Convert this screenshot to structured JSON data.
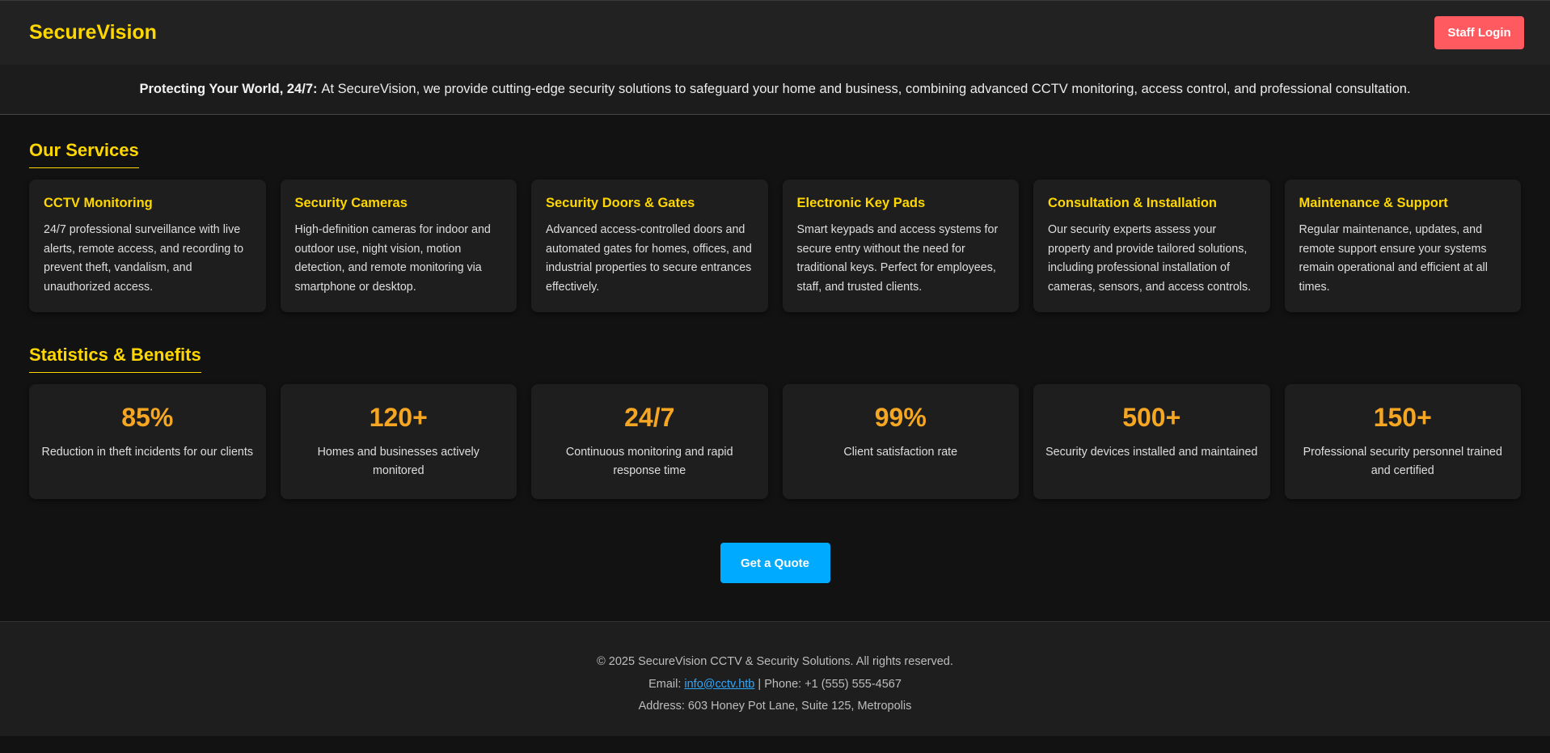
{
  "header": {
    "brand": "SecureVision",
    "login_label": "Staff Login"
  },
  "intro": {
    "lead": "Protecting Your World, 24/7:",
    "text": "At SecureVision, we provide cutting-edge security solutions to safeguard your home and business, combining advanced CCTV monitoring, access control, and professional consultation."
  },
  "services": {
    "title": "Our Services",
    "items": [
      {
        "title": "CCTV Monitoring",
        "desc": "24/7 professional surveillance with live alerts, remote access, and recording to prevent theft, vandalism, and unauthorized access."
      },
      {
        "title": "Security Cameras",
        "desc": "High-definition cameras for indoor and outdoor use, night vision, motion detection, and remote monitoring via smartphone or desktop."
      },
      {
        "title": "Security Doors & Gates",
        "desc": "Advanced access-controlled doors and automated gates for homes, offices, and industrial properties to secure entrances effectively."
      },
      {
        "title": "Electronic Key Pads",
        "desc": "Smart keypads and access systems for secure entry without the need for traditional keys. Perfect for employees, staff, and trusted clients."
      },
      {
        "title": "Consultation & Installation",
        "desc": "Our security experts assess your property and provide tailored solutions, including professional installation of cameras, sensors, and access controls."
      },
      {
        "title": "Maintenance & Support",
        "desc": "Regular maintenance, updates, and remote support ensure your systems remain operational and efficient at all times."
      }
    ]
  },
  "stats": {
    "title": "Statistics & Benefits",
    "items": [
      {
        "value": "85%",
        "label": "Reduction in theft incidents for our clients"
      },
      {
        "value": "120+",
        "label": "Homes and businesses actively monitored"
      },
      {
        "value": "24/7",
        "label": "Continuous monitoring and rapid response time"
      },
      {
        "value": "99%",
        "label": "Client satisfaction rate"
      },
      {
        "value": "500+",
        "label": "Security devices installed and maintained"
      },
      {
        "value": "150+",
        "label": "Professional security personnel trained and certified"
      }
    ]
  },
  "cta": {
    "label": "Get a Quote"
  },
  "footer": {
    "copyright": "© 2025 SecureVision CCTV & Security Solutions. All rights reserved.",
    "email_prefix": "Email:",
    "email": "info@cctv.htb",
    "phone": "| Phone: +1 (555) 555-4567",
    "address": "Address: 603 Honey Pot Lane, Suite 125, Metropolis"
  },
  "colors": {
    "background": "#121212",
    "accent_yellow": "#ffd700",
    "stat_orange": "#f5a623",
    "login_red": "#ff5a5f",
    "cta_blue": "#00aaff"
  }
}
